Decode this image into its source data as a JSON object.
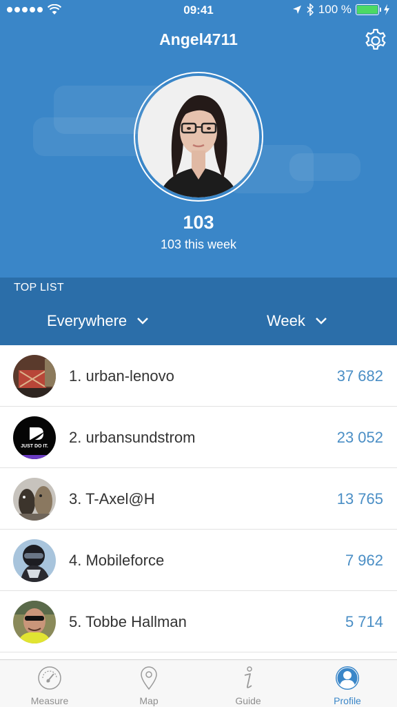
{
  "status_bar": {
    "time": "09:41",
    "battery": "100 %"
  },
  "profile": {
    "username": "Angel4711",
    "score": "103",
    "score_week": "103 this week"
  },
  "toplist": {
    "title": "TOP LIST",
    "location_filter": "Everywhere",
    "period_filter": "Week",
    "entries": [
      {
        "name": "1. urban-lenovo",
        "points": "37 682"
      },
      {
        "name": "2. urbansundstrom",
        "points": "23 052"
      },
      {
        "name": "3. T-Axel@H",
        "points": "13 765"
      },
      {
        "name": "4. Mobileforce",
        "points": "7 962"
      },
      {
        "name": "5. Tobbe Hallman",
        "points": "5 714"
      }
    ]
  },
  "avatar_badge_text": "JUST DO IT.",
  "tabs": [
    {
      "label": "Measure",
      "icon": "gauge-icon"
    },
    {
      "label": "Map",
      "icon": "map-pin-icon"
    },
    {
      "label": "Guide",
      "icon": "info-icon"
    },
    {
      "label": "Profile",
      "icon": "profile-icon",
      "active": true
    }
  ],
  "colors": {
    "header": "#3a86c8",
    "toplist_bar": "#2b6ea9",
    "points": "#4a8ec5",
    "active_tab": "#3a86c8",
    "battery": "#4cd964"
  }
}
